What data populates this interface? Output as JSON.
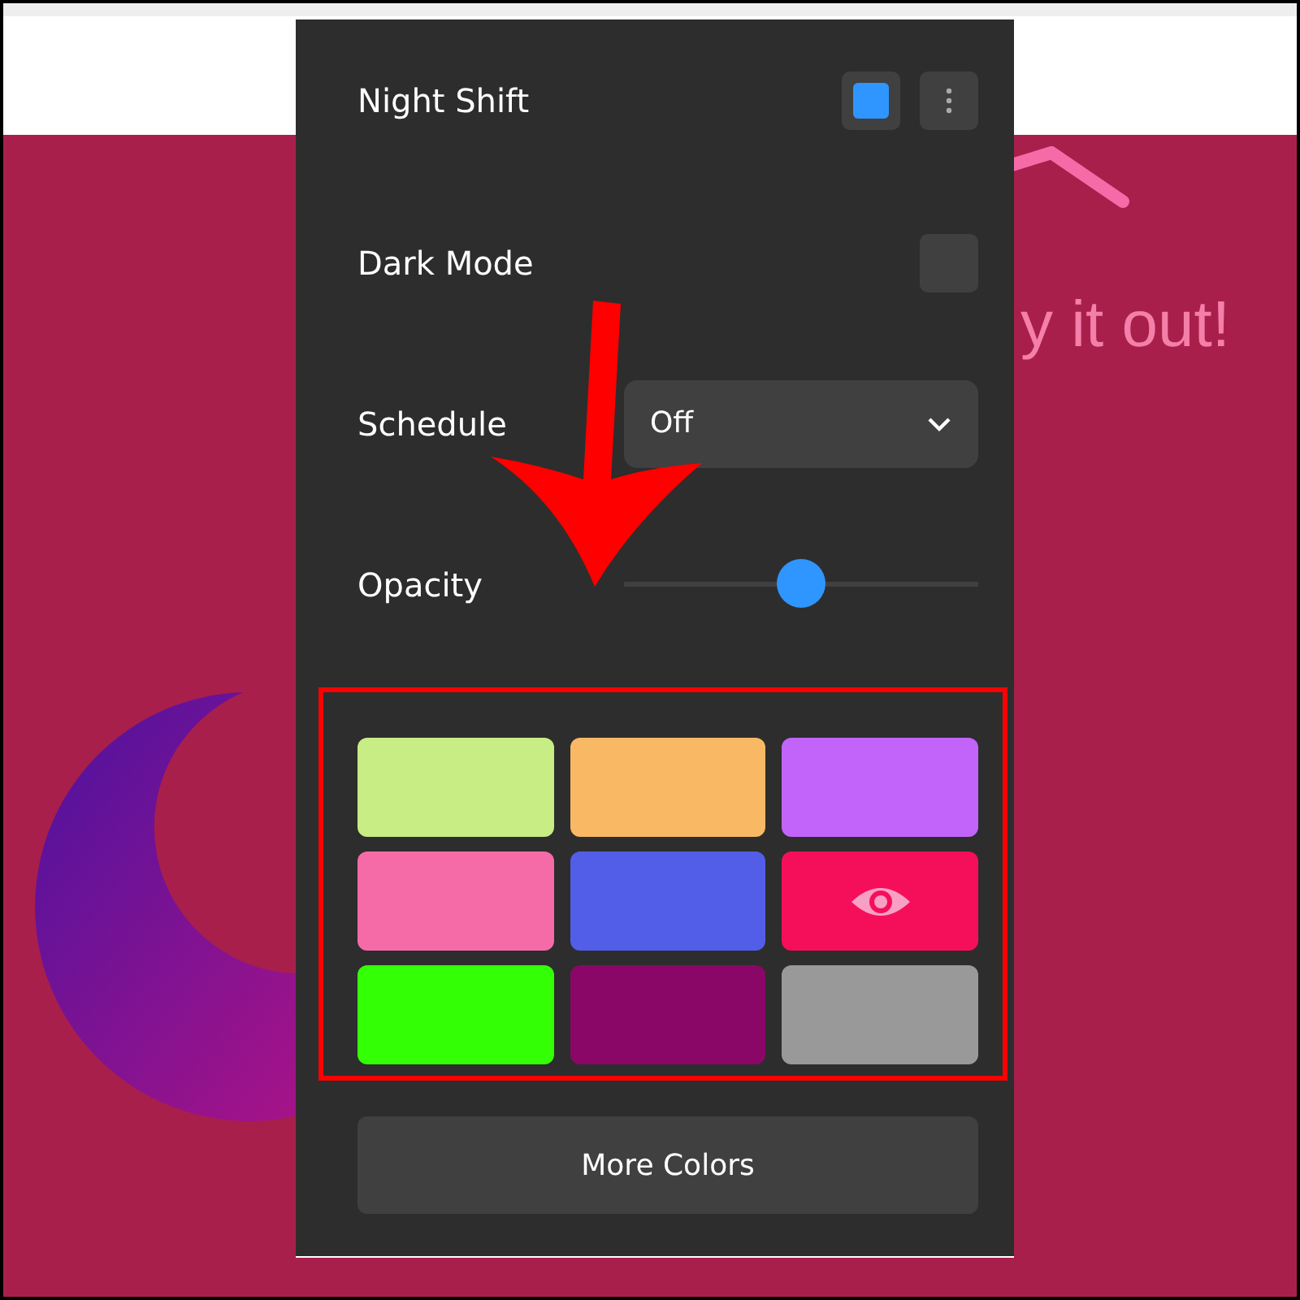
{
  "background_text": "y it out!",
  "header": {
    "title": "Night Shift",
    "enabled": true
  },
  "settings": [
    {
      "kind": "toggle",
      "label": "Dark Mode",
      "checked": false
    },
    {
      "kind": "select",
      "label": "Schedule",
      "value": "Off"
    },
    {
      "kind": "slider",
      "label": "Opacity",
      "level": 0.5
    }
  ],
  "swatches": [
    {
      "color": "#c7ed84",
      "selected": false
    },
    {
      "color": "#f9b964",
      "selected": false
    },
    {
      "color": "#c264f9",
      "selected": false
    },
    {
      "color": "#f56ba8",
      "selected": false
    },
    {
      "color": "#525ee8",
      "selected": false
    },
    {
      "color": "#f50f5a",
      "selected": true
    },
    {
      "color": "#33ff05",
      "selected": false
    },
    {
      "color": "#8a0768",
      "selected": false
    },
    {
      "color": "#999999",
      "selected": false
    }
  ],
  "more_button": "More Colors"
}
